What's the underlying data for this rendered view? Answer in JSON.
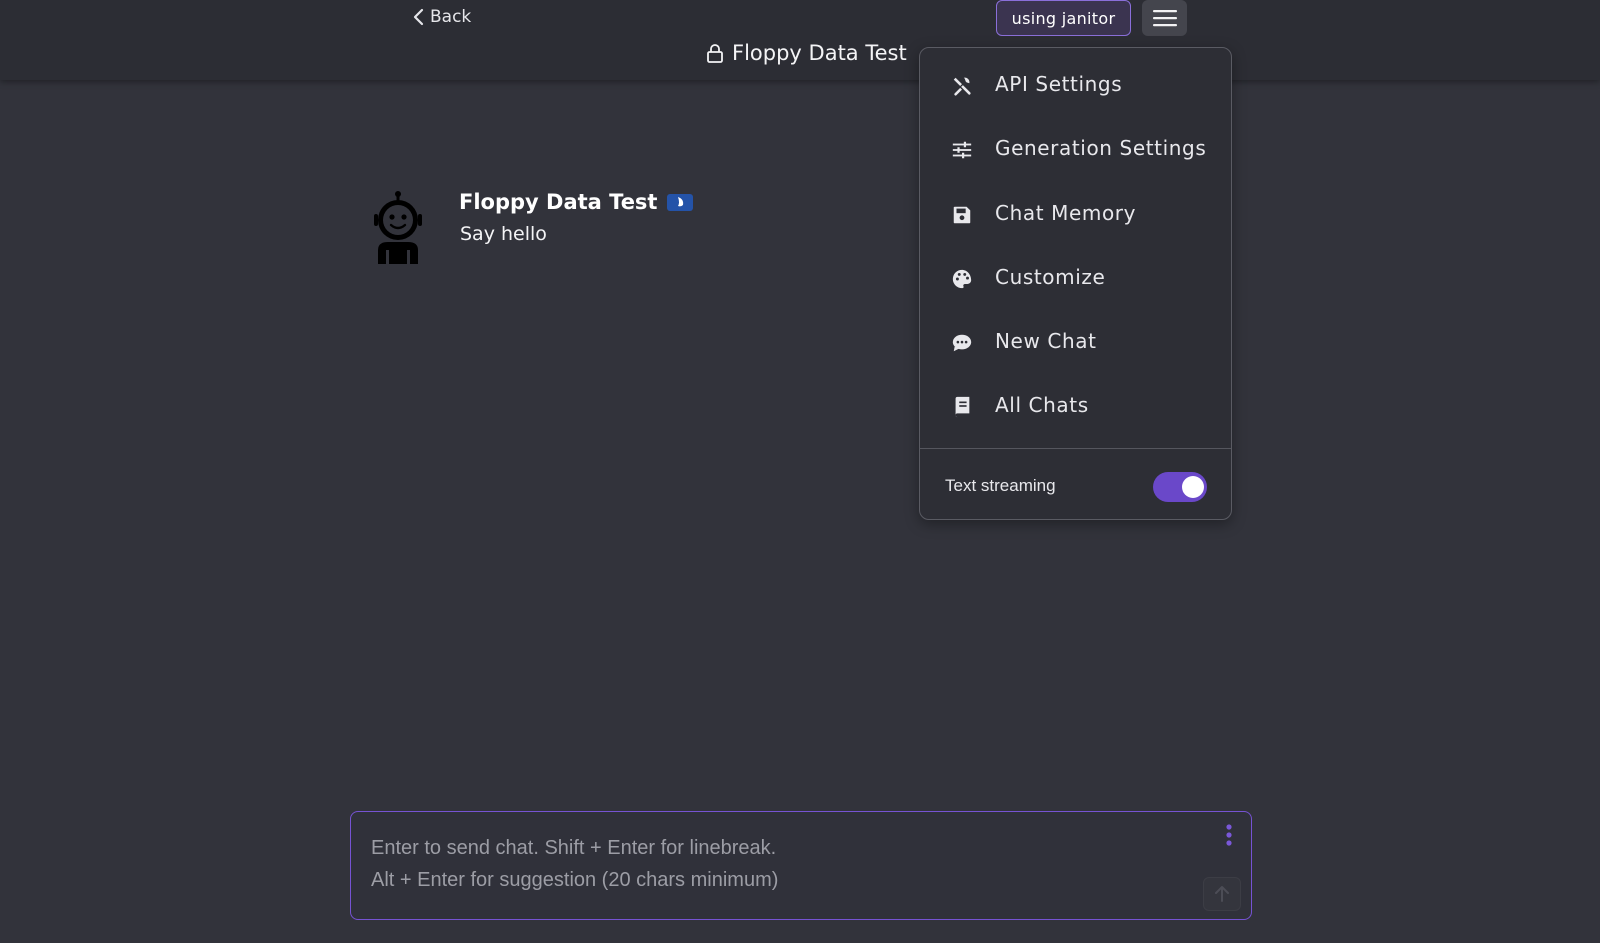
{
  "header": {
    "back_label": "Back",
    "title": "Floppy Data Test",
    "title_icon": "lock-icon",
    "api_badge": "using janitor",
    "menu_icon": "hamburger-menu-icon"
  },
  "message": {
    "avatar_icon": "robot-avatar",
    "name": "Floppy Data Test",
    "badge_icon": "bot-badge-icon",
    "text": "Say hello"
  },
  "dropdown": {
    "items": [
      {
        "label": "API Settings",
        "icon": "tools-icon"
      },
      {
        "label": "Generation Settings",
        "icon": "sliders-icon"
      },
      {
        "label": "Chat Memory",
        "icon": "floppy-disk-icon"
      },
      {
        "label": "Customize",
        "icon": "palette-icon"
      },
      {
        "label": "New Chat",
        "icon": "chat-bubble-icon"
      },
      {
        "label": "All Chats",
        "icon": "book-icon"
      }
    ],
    "text_streaming_label": "Text streaming",
    "text_streaming_enabled": true
  },
  "composer": {
    "placeholder": "Enter to send chat. Shift + Enter for linebreak.\nAlt + Enter for suggestion (20 chars minimum)",
    "value": ""
  },
  "colors": {
    "background": "#32333b",
    "accent": "#6a48c9",
    "badge_border": "#8a6fd9",
    "bot_badge": "#2453a8"
  }
}
